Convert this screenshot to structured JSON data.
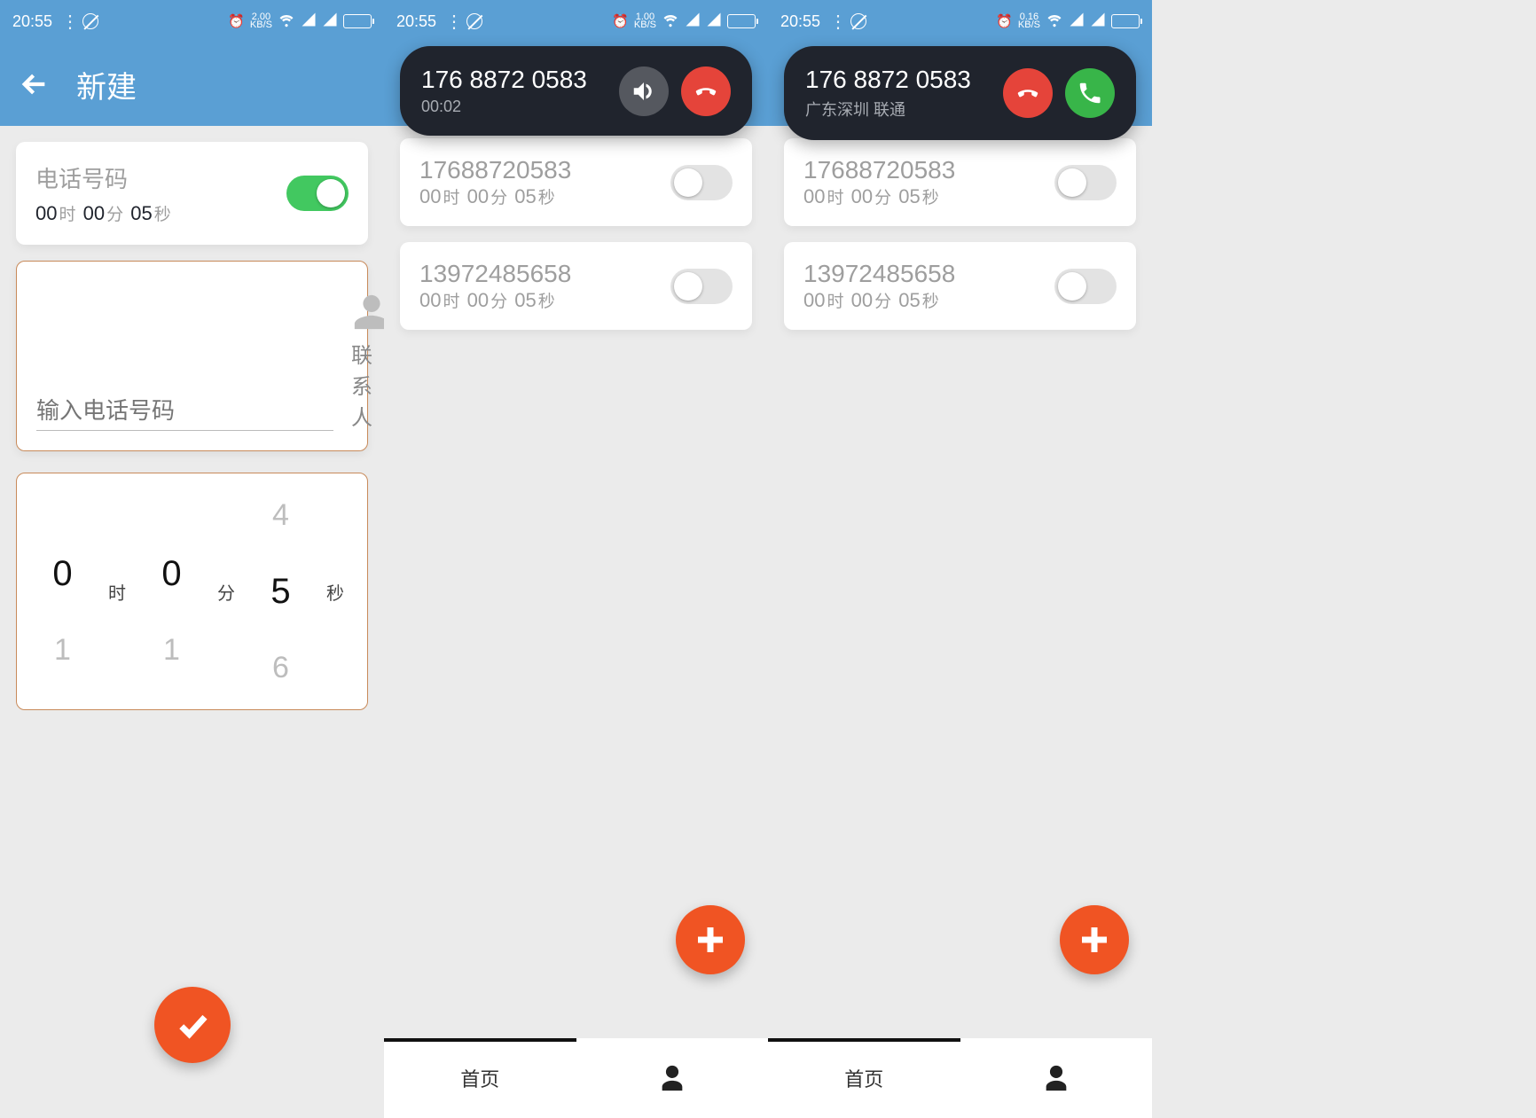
{
  "status": {
    "time": "20:55",
    "speeds": [
      "2.00",
      "1.00",
      "0.16"
    ],
    "speed_unit": "KB/S"
  },
  "s1": {
    "title": "新建",
    "phone_label": "电话号码",
    "duration": {
      "h": "00",
      "hl": "时",
      "m": "00",
      "ml": "分",
      "s": "05",
      "sl": "秒"
    },
    "input_placeholder": "输入电话号码",
    "contact_label": "联系人",
    "picker": {
      "h_prev": "",
      "h_cur": "0",
      "h_next": "1",
      "h_unit": "时",
      "m_prev": "",
      "m_cur": "0",
      "m_next": "1",
      "m_unit": "分",
      "s_prev": "4",
      "s_cur": "5",
      "s_next": "6",
      "s_unit": "秒"
    }
  },
  "s2": {
    "call_number": "176 8872 0583",
    "call_sub": "00:02",
    "list": [
      {
        "number": "17688720583",
        "dur": {
          "h": "00",
          "m": "00",
          "s": "05"
        }
      },
      {
        "number": "13972485658",
        "dur": {
          "h": "00",
          "m": "00",
          "s": "05"
        }
      }
    ],
    "nav_home": "首页"
  },
  "s3": {
    "call_number": "176 8872 0583",
    "call_sub": "广东深圳 联通",
    "list": [
      {
        "number": "17688720583",
        "dur": {
          "h": "00",
          "m": "00",
          "s": "05"
        }
      },
      {
        "number": "13972485658",
        "dur": {
          "h": "00",
          "m": "00",
          "s": "05"
        }
      }
    ],
    "nav_home": "首页"
  },
  "labels": {
    "hl": "时",
    "ml": "分",
    "sl": "秒"
  }
}
